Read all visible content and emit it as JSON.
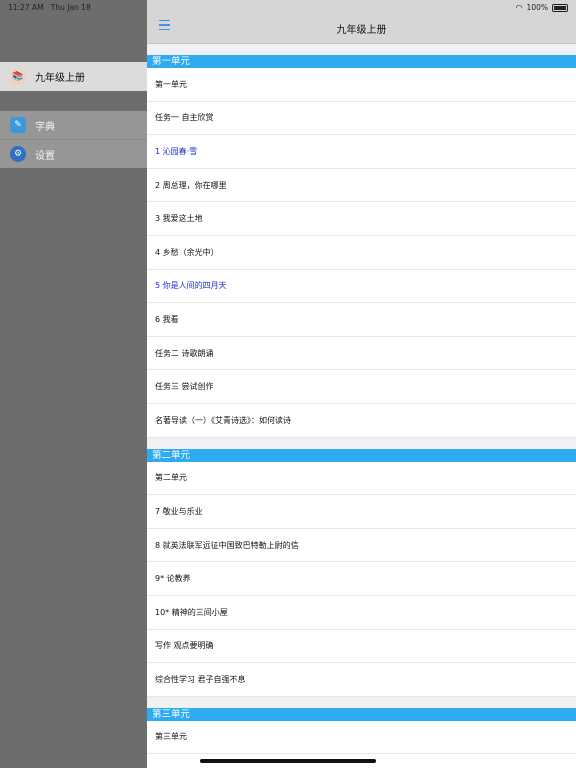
{
  "status": {
    "time": "11:27 AM",
    "date": "Thu Jan 18",
    "battery": "100%"
  },
  "sidebar": {
    "items": [
      {
        "label": "九年级上册",
        "icon": "book-icon"
      },
      {
        "label": "字典",
        "icon": "dictionary-icon"
      },
      {
        "label": "设置",
        "icon": "gear-icon"
      }
    ]
  },
  "navbar": {
    "title": "九年级上册",
    "menu_icon": "hamburger-menu-icon"
  },
  "sections": [
    {
      "header": "第一单元",
      "rows": [
        {
          "text": "第一单元"
        },
        {
          "text": "任务一 自主欣赏"
        },
        {
          "text": "1 沁园春·雪",
          "highlight": true
        },
        {
          "text": "2 周总理，你在哪里"
        },
        {
          "text": "3 我爱这土地"
        },
        {
          "text": "4 乡愁（余光中）"
        },
        {
          "text": "5 你是人间的四月天",
          "highlight": true
        },
        {
          "text": "6 我看"
        },
        {
          "text": "任务二 诗歌朗诵"
        },
        {
          "text": "任务三 尝试创作"
        },
        {
          "text": "名著导读（一）《艾青诗选》：如何读诗"
        }
      ]
    },
    {
      "header": "第二单元",
      "rows": [
        {
          "text": "第二单元"
        },
        {
          "text": "7 敬业与乐业"
        },
        {
          "text": "8 就英法联军远征中国致巴特勒上尉的信"
        },
        {
          "text": "9* 论教养"
        },
        {
          "text": "10* 精神的三间小屋"
        },
        {
          "text": "写作 观点要明确"
        },
        {
          "text": "综合性学习 君子自强不息"
        }
      ]
    },
    {
      "header": "第三单元",
      "rows": [
        {
          "text": "第三单元"
        }
      ]
    }
  ],
  "colors": {
    "section_header": "#2daaf0",
    "highlight_text": "#1a2fd0",
    "accent": "#4a90e2"
  }
}
